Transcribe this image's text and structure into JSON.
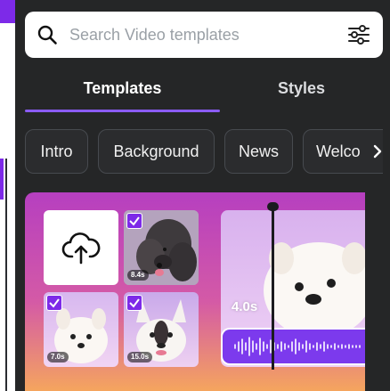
{
  "search": {
    "placeholder": "Search Video templates",
    "value": ""
  },
  "tabs": [
    {
      "label": "Templates",
      "active": true
    },
    {
      "label": "Styles",
      "active": false
    }
  ],
  "chips": [
    {
      "label": "Intro"
    },
    {
      "label": "Background"
    },
    {
      "label": "News"
    },
    {
      "label": "Welco"
    }
  ],
  "template_card": {
    "clips": [
      {
        "duration": "8.4s",
        "subject": "poodle",
        "checked": true
      },
      {
        "duration": "7.0s",
        "subject": "pomeranian",
        "checked": true
      },
      {
        "duration": "15.0s",
        "subject": "french-bulldog",
        "checked": true
      }
    ],
    "preview_duration": "4.0s"
  },
  "icons": {
    "search": "search-icon",
    "filter": "sliders-icon",
    "upload": "cloud-upload-icon",
    "next": "chevron-right-icon"
  },
  "colors": {
    "panel_bg": "#252627",
    "accent": "#7d2ae8",
    "tab_underline": "#8b5cf6",
    "chip_border": "#474a4f"
  }
}
